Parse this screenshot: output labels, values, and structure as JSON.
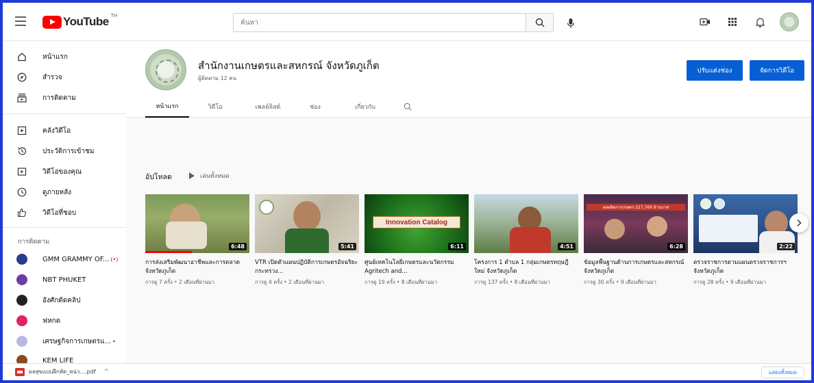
{
  "topbar": {
    "logo_text": "YouTube",
    "region": "TH",
    "search_placeholder": "ค้นหา"
  },
  "sidebar": {
    "items": [
      {
        "label": "หน้าแรก",
        "icon": "home-icon"
      },
      {
        "label": "สำรวจ",
        "icon": "explore-icon"
      },
      {
        "label": "การติดตาม",
        "icon": "subscriptions-icon"
      },
      {
        "label": "คลังวิดีโอ",
        "icon": "library-icon"
      },
      {
        "label": "ประวัติการเข้าชม",
        "icon": "history-icon"
      },
      {
        "label": "วิดีโอของคุณ",
        "icon": "your-videos-icon"
      },
      {
        "label": "ดูภายหลัง",
        "icon": "watch-later-icon"
      },
      {
        "label": "วิดีโอที่ชอบ",
        "icon": "liked-videos-icon"
      }
    ],
    "subscriptions_heading": "การติดตาม",
    "subscriptions": [
      {
        "label": "GMM GRAMMY OF...",
        "live": "(•)",
        "color": "#2a3c8f"
      },
      {
        "label": "NBT PHUKET",
        "live": "",
        "color": "#6b3fa0"
      },
      {
        "label": "อังศักดัดคลิป",
        "live": "",
        "color": "#222222"
      },
      {
        "label": "ฟหกด",
        "live": "",
        "color": "#e0245e"
      },
      {
        "label": "เศรษฐกิจการเกษตรแ...",
        "live": "•",
        "color": "#b8b8e8"
      },
      {
        "label": "KEM LIFE",
        "live": "",
        "color": "#8a4b1f"
      }
    ]
  },
  "channel": {
    "title": "สำนักงานเกษตรและสหกรณ์ จังหวัดภูเก็ต",
    "subscribers": "ผู้ติดตาม 12 คน",
    "customize_label": "ปรับแต่งช่อง",
    "manage_label": "จัดการวิดีโอ",
    "tabs": [
      "หน้าแรก",
      "วิดีโอ",
      "เพลย์ลิสต์",
      "ช่อง",
      "เกี่ยวกับ"
    ]
  },
  "uploads": {
    "title": "อัปโหลด",
    "play_all": "เล่นทั้งหมด",
    "videos": [
      {
        "title": "การส่งเสริมพัฒนาอาชีพและการตลาด จังหวัดภูเก็ต",
        "meta": "การดู 7 ครั้ง • 2 เดือนที่ผ่านมา",
        "duration": "6:48",
        "thumb_text": "",
        "progress": 0.45
      },
      {
        "title": "VTR เปิดตัวแผนปฏิบัติการเกษตรอัจฉริยะ กระทรวง...",
        "meta": "การดู 4 ครั้ง • 2 เดือนที่ผ่านมา",
        "duration": "5:41",
        "thumb_text": "",
        "progress": 0.0
      },
      {
        "title": "ศูนย์เทคโนโลยีเกษตรและนวัตกรรม Agritech and...",
        "meta": "การดู 19 ครั้ง • 8 เดือนที่ผ่านมา",
        "duration": "6:11",
        "thumb_text": "Innovation Catalog",
        "progress": 0.0
      },
      {
        "title": "โครงการ 1 ตำบล 1 กลุ่มเกษตรทฤษฎีใหม่ จังหวัดภูเก็ต",
        "meta": "การดู 137 ครั้ง • 8 เดือนที่ผ่านมา",
        "duration": "4:51",
        "thumb_text": "",
        "progress": 0.0
      },
      {
        "title": "ข้อมูลพื้นฐานด้านการเกษตรและสหกรณ์จังหวัดภูเก็ต",
        "meta": "การดู 30 ครั้ง • 9 เดือนที่ผ่านมา",
        "duration": "6:28",
        "thumb_text": "ผลผลิตการเกษตร 227,769 ล้านบาท",
        "progress": 0.0
      },
      {
        "title": "ตรวจราชการตามแผนตรวจราชการฯ จังหวัดภูเก็ต",
        "meta": "การดู 28 ครั้ง • 9 เดือนที่ผ่านมา",
        "duration": "2:22",
        "thumb_text": "",
        "progress": 0.0
      }
    ]
  },
  "downloads": {
    "file_name": "ผลสุขแบบฝึกหัด_หน่ว....pdf",
    "show_all": "แสดงทั้งหมด"
  },
  "colors": {
    "accent": "#065fd4",
    "brand": "#ff0000"
  }
}
